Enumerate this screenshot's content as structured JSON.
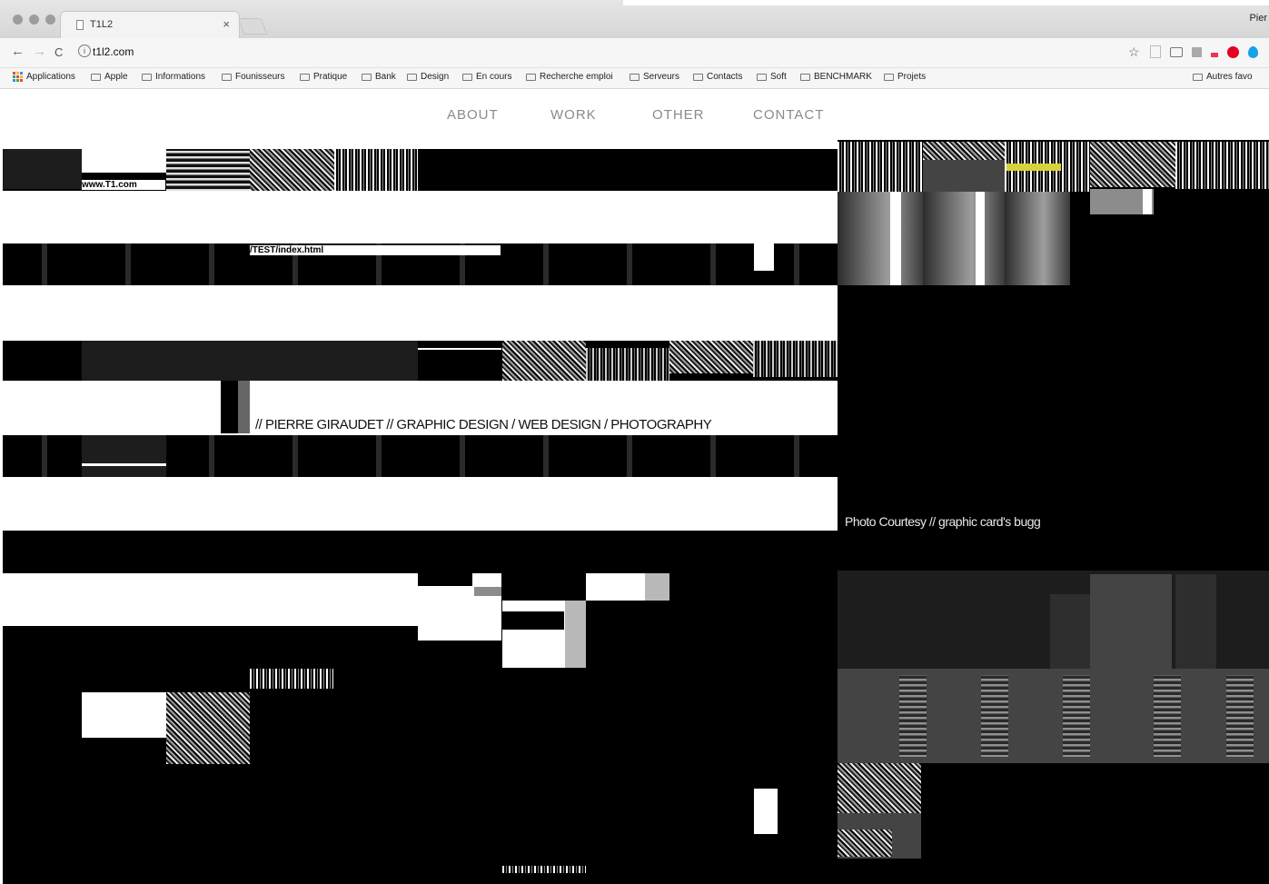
{
  "browser": {
    "tab_title": "T1L2",
    "tab_close": "×",
    "profile_name": "Pier",
    "url": "t1l2.com",
    "nav": {
      "back": "←",
      "forward": "→",
      "reload": "C"
    }
  },
  "bookmarks": {
    "apps": "Applications",
    "items": [
      "Apple",
      "Informations",
      "Founisseurs",
      "Pratique",
      "Bank",
      "Design",
      "En cours",
      "Recherche emploi",
      "Serveurs",
      "Contacts",
      "Soft",
      "BENCHMARK",
      "Projets"
    ],
    "others": "Autres favo"
  },
  "site_nav": {
    "about": "ABOUT",
    "work": "WORK",
    "other": "OTHER",
    "contact": "CONTACT"
  },
  "glitch": {
    "url_fragment": "www.T1.com",
    "path_fragment": "/TEST/index.html"
  },
  "headline": "// PIERRE GIRAUDET // GRAPHIC DESIGN / WEB DESIGN / PHOTOGRAPHY",
  "courtesy": "Photo Courtesy // graphic card's bugg",
  "colors": {
    "accent_pinterest": "#e60023",
    "accent_ext": "#1aa1e8",
    "glitch_yellow": "#d8d23a"
  }
}
